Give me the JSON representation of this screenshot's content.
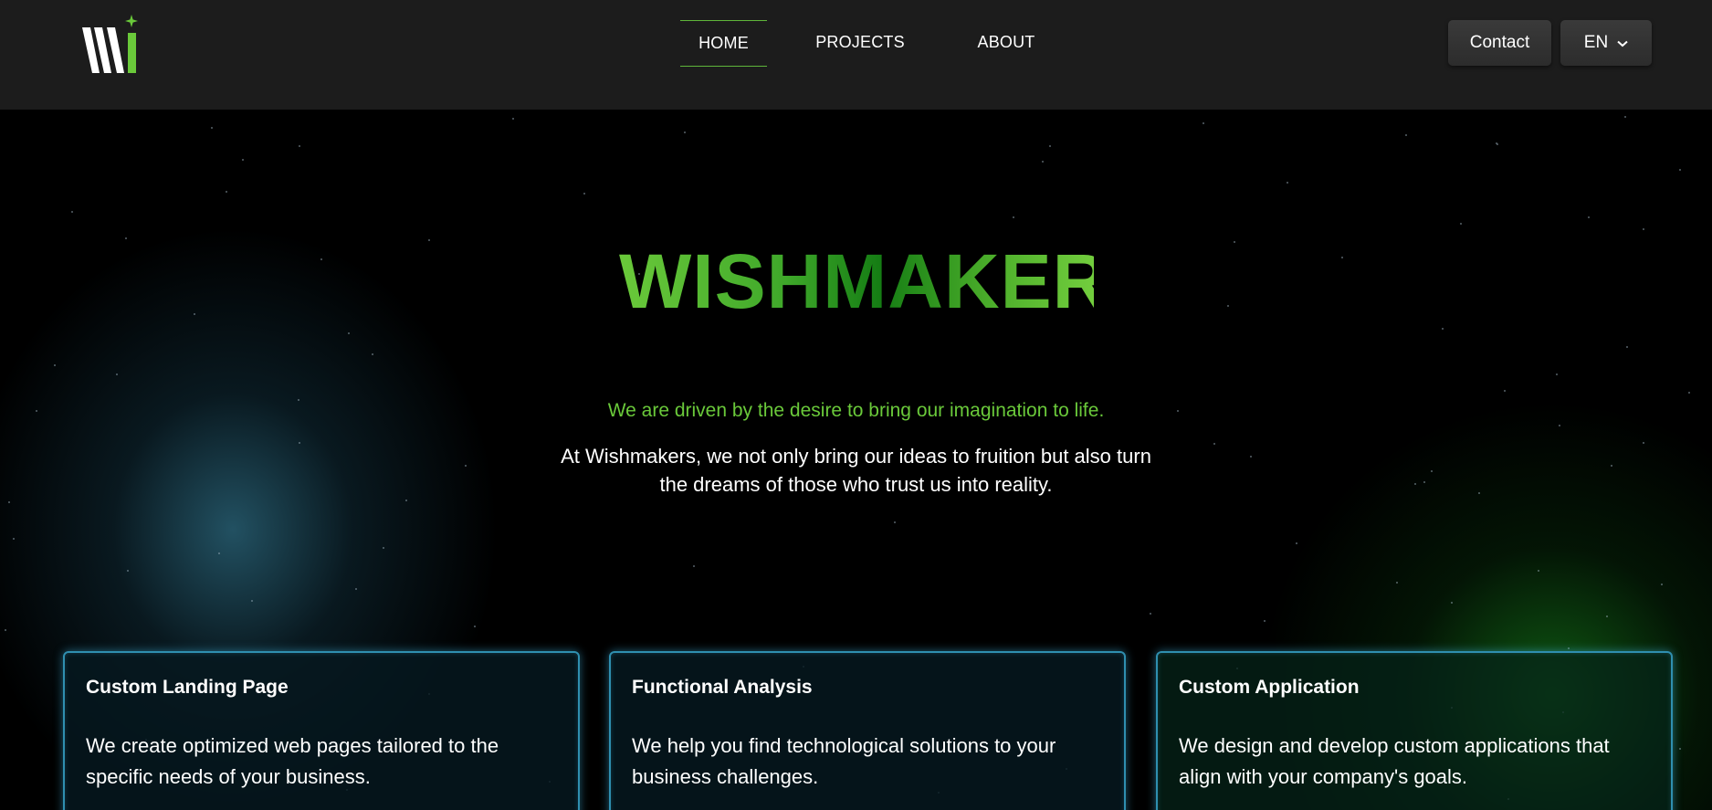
{
  "header": {
    "logo": {
      "brand_color": "#6ac93a"
    },
    "nav": [
      {
        "label": "HOME",
        "active": true
      },
      {
        "label": "PROJECTS",
        "active": false
      },
      {
        "label": "ABOUT",
        "active": false
      }
    ],
    "contact_label": "Contact",
    "language": {
      "selected": "EN",
      "icon": "chevron-down-icon"
    }
  },
  "hero": {
    "title": "WISHMAKERS",
    "tagline": "We are driven by the desire to bring our imagination to life.",
    "description": "At Wishmakers, we not only bring our ideas to fruition but also turn the dreams of those who trust us into reality."
  },
  "services": [
    {
      "title": "Custom Landing Page",
      "text": "We create optimized web pages tailored to the specific needs of your business."
    },
    {
      "title": "Functional Analysis",
      "text": "We help you find technological solutions to your business challenges."
    },
    {
      "title": "Custom Application",
      "text": "We design and develop custom applications that align with your company's goals."
    }
  ],
  "colors": {
    "accent": "#6ac93a",
    "header_bg": "#1c1c1c",
    "card_border": "#2f8fb0"
  }
}
